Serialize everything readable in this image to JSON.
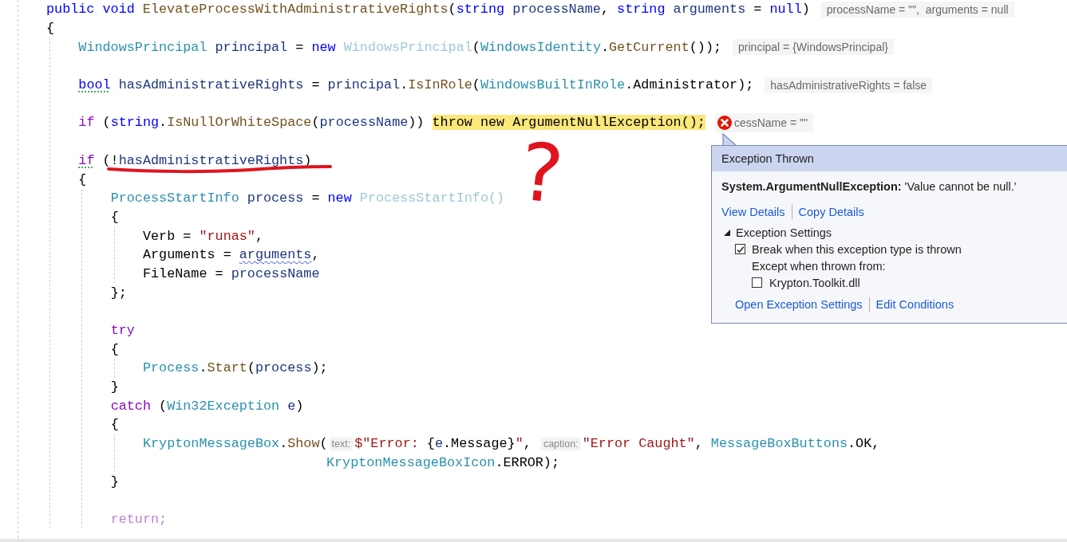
{
  "code_lines": [
    {
      "kind": "code",
      "tokens": [
        {
          "t": "public void ",
          "kind": "kw"
        },
        {
          "t": "ElevateProcessWithAdministrativeRights",
          "kind": "method"
        },
        {
          "t": "(",
          "kind": "plain"
        },
        {
          "t": "string ",
          "kind": "kw"
        },
        {
          "t": "processName",
          "kind": "param"
        },
        {
          "t": ", ",
          "kind": "plain"
        },
        {
          "t": "string ",
          "kind": "kw"
        },
        {
          "t": "arguments",
          "kind": "param"
        },
        {
          "t": " = ",
          "kind": "plain"
        },
        {
          "t": "null",
          "kind": "kw"
        },
        {
          "t": ")",
          "kind": "plain"
        }
      ],
      "datatip": {
        "text": "processName = \"\",  arguments = null",
        "error": false
      }
    },
    {
      "kind": "code",
      "tokens": [
        {
          "t": "{",
          "kind": "plain"
        }
      ],
      "children": [
        {
          "kind": "code",
          "tokens": [
            {
              "t": "WindowsPrincipal ",
              "kind": "type"
            },
            {
              "t": "principal",
              "kind": "local"
            },
            {
              "t": " = ",
              "kind": "plain"
            },
            {
              "t": "new ",
              "kind": "kw"
            },
            {
              "t": "WindowsPrincipal",
              "kind": "faded"
            },
            {
              "t": "(",
              "kind": "plain"
            },
            {
              "t": "WindowsIdentity",
              "kind": "type"
            },
            {
              "t": ".",
              "kind": "plain"
            },
            {
              "t": "GetCurrent",
              "kind": "method"
            },
            {
              "t": "());",
              "kind": "plain"
            }
          ],
          "datatip": {
            "text": "principal = {WindowsPrincipal}",
            "error": false
          }
        },
        {
          "kind": "blank"
        },
        {
          "kind": "code",
          "tokens": [
            {
              "t": "bool",
              "kind": "kw",
              "dotted_underline": true
            },
            {
              "t": " hasAdministrativeRights",
              "kind": "local"
            },
            {
              "t": " = ",
              "kind": "plain"
            },
            {
              "t": "principal",
              "kind": "local"
            },
            {
              "t": ".",
              "kind": "plain"
            },
            {
              "t": "IsInRole",
              "kind": "method"
            },
            {
              "t": "(",
              "kind": "plain"
            },
            {
              "t": "WindowsBuiltInRole",
              "kind": "type"
            },
            {
              "t": ".Administrator);",
              "kind": "plain"
            }
          ],
          "datatip": {
            "text": "hasAdministrativeRights = false",
            "error": false
          }
        },
        {
          "kind": "blank"
        },
        {
          "kind": "code",
          "tokens": [
            {
              "t": "if",
              "kind": "ctl"
            },
            {
              "t": " (",
              "kind": "plain"
            },
            {
              "t": "string",
              "kind": "kw"
            },
            {
              "t": ".",
              "kind": "plain"
            },
            {
              "t": "IsNullOrWhiteSpace",
              "kind": "method"
            },
            {
              "t": "(",
              "kind": "plain"
            },
            {
              "t": "processName",
              "kind": "param"
            },
            {
              "t": ")) ",
              "kind": "plain"
            },
            {
              "t": "throw new ArgumentNullException();",
              "kind": "plain",
              "highlight": true
            }
          ],
          "datatip": {
            "text": "cessName = \"\"",
            "error": true
          }
        },
        {
          "kind": "blank"
        },
        {
          "kind": "code",
          "tokens": [
            {
              "t": "if",
              "kind": "ctl",
              "dotted_underline": true
            },
            {
              "t": " (!",
              "kind": "plain"
            },
            {
              "t": "hasAdministrativeRights",
              "kind": "local"
            },
            {
              "t": ")",
              "kind": "plain"
            }
          ]
        },
        {
          "kind": "code",
          "tokens": [
            {
              "t": "{",
              "kind": "plain"
            }
          ],
          "children": [
            {
              "kind": "code",
              "tokens": [
                {
                  "t": "ProcessStartInfo ",
                  "kind": "type"
                },
                {
                  "t": "process",
                  "kind": "local"
                },
                {
                  "t": " = ",
                  "kind": "plain"
                },
                {
                  "t": "new ",
                  "kind": "kw"
                },
                {
                  "t": "ProcessStartInfo()",
                  "kind": "faded"
                }
              ]
            },
            {
              "kind": "code",
              "tokens": [
                {
                  "t": "{",
                  "kind": "plain"
                }
              ],
              "children": [
                {
                  "kind": "code",
                  "tokens": [
                    {
                      "t": "Verb = ",
                      "kind": "plain"
                    },
                    {
                      "t": "\"runas\"",
                      "kind": "str"
                    },
                    {
                      "t": ",",
                      "kind": "plain"
                    }
                  ]
                },
                {
                  "kind": "code",
                  "tokens": [
                    {
                      "t": "Arguments = ",
                      "kind": "plain"
                    },
                    {
                      "t": "arguments",
                      "kind": "param",
                      "wavy_underline": true
                    },
                    {
                      "t": ",",
                      "kind": "plain"
                    }
                  ]
                },
                {
                  "kind": "code",
                  "tokens": [
                    {
                      "t": "FileName = ",
                      "kind": "plain"
                    },
                    {
                      "t": "processName",
                      "kind": "param"
                    }
                  ]
                }
              ]
            },
            {
              "kind": "code",
              "tokens": [
                {
                  "t": "};",
                  "kind": "plain"
                }
              ]
            },
            {
              "kind": "blank"
            },
            {
              "kind": "code",
              "tokens": [
                {
                  "t": "try",
                  "kind": "ctl"
                }
              ]
            },
            {
              "kind": "code",
              "tokens": [
                {
                  "t": "{",
                  "kind": "plain"
                }
              ],
              "children": [
                {
                  "kind": "code",
                  "tokens": [
                    {
                      "t": "Process",
                      "kind": "type"
                    },
                    {
                      "t": ".",
                      "kind": "plain"
                    },
                    {
                      "t": "Start",
                      "kind": "method"
                    },
                    {
                      "t": "(",
                      "kind": "plain"
                    },
                    {
                      "t": "process",
                      "kind": "local"
                    },
                    {
                      "t": ");",
                      "kind": "plain"
                    }
                  ]
                }
              ]
            },
            {
              "kind": "code",
              "tokens": [
                {
                  "t": "}",
                  "kind": "plain"
                }
              ]
            },
            {
              "kind": "code",
              "tokens": [
                {
                  "t": "catch",
                  "kind": "ctl"
                },
                {
                  "t": " (",
                  "kind": "plain"
                },
                {
                  "t": "Win32Exception",
                  "kind": "type"
                },
                {
                  "t": " e",
                  "kind": "local"
                },
                {
                  "t": ")",
                  "kind": "plain"
                }
              ]
            },
            {
              "kind": "code",
              "tokens": [
                {
                  "t": "{",
                  "kind": "plain"
                }
              ],
              "children": [
                {
                  "kind": "code",
                  "tokens": [
                    {
                      "t": "KryptonMessageBox",
                      "kind": "type"
                    },
                    {
                      "t": ".",
                      "kind": "plain"
                    },
                    {
                      "t": "Show",
                      "kind": "method"
                    },
                    {
                      "t": "(",
                      "kind": "plain"
                    },
                    {
                      "t": "text:",
                      "kind": "hint"
                    },
                    {
                      "t": "$\"Error: ",
                      "kind": "str"
                    },
                    {
                      "t": "{",
                      "kind": "plain"
                    },
                    {
                      "t": "e",
                      "kind": "local"
                    },
                    {
                      "t": ".Message}",
                      "kind": "plain"
                    },
                    {
                      "t": "\"",
                      "kind": "str"
                    },
                    {
                      "t": ", ",
                      "kind": "plain"
                    },
                    {
                      "t": "caption:",
                      "kind": "hint"
                    },
                    {
                      "t": "\"Error Caught\"",
                      "kind": "str"
                    },
                    {
                      "t": ", ",
                      "kind": "plain"
                    },
                    {
                      "t": "MessageBoxButtons",
                      "kind": "type"
                    },
                    {
                      "t": ".OK,",
                      "kind": "plain"
                    }
                  ]
                },
                {
                  "kind": "continuation",
                  "tokens": [
                    {
                      "t": "KryptonMessageBoxIcon",
                      "kind": "type"
                    },
                    {
                      "t": ".ERROR);",
                      "kind": "plain"
                    }
                  ]
                }
              ]
            },
            {
              "kind": "code",
              "tokens": [
                {
                  "t": "}",
                  "kind": "plain"
                }
              ]
            },
            {
              "kind": "blank"
            },
            {
              "kind": "code",
              "tokens": [
                {
                  "t": "return;",
                  "kind": "ctl-faded"
                }
              ]
            }
          ]
        }
      ]
    }
  ],
  "annotations": [
    {
      "kind": "underline"
    },
    {
      "kind": "text",
      "text": "?"
    }
  ],
  "exception_popup": {
    "title": "Exception Thrown",
    "message": "**System.ArgumentNullException:** 'Value cannot be null.'",
    "links": [
      "View Details",
      "Copy Details"
    ],
    "settings": {
      "label": "Exception Settings",
      "expanded": true,
      "break_option": {
        "label": "Break when this exception type is thrown",
        "checked": true
      },
      "except_label": "Except when thrown from:",
      "modules": [
        {
          "label": "Krypton.Toolkit.dll",
          "checked": false
        }
      ]
    },
    "footer_links": [
      "Open Exception Settings",
      "Edit Conditions"
    ]
  }
}
